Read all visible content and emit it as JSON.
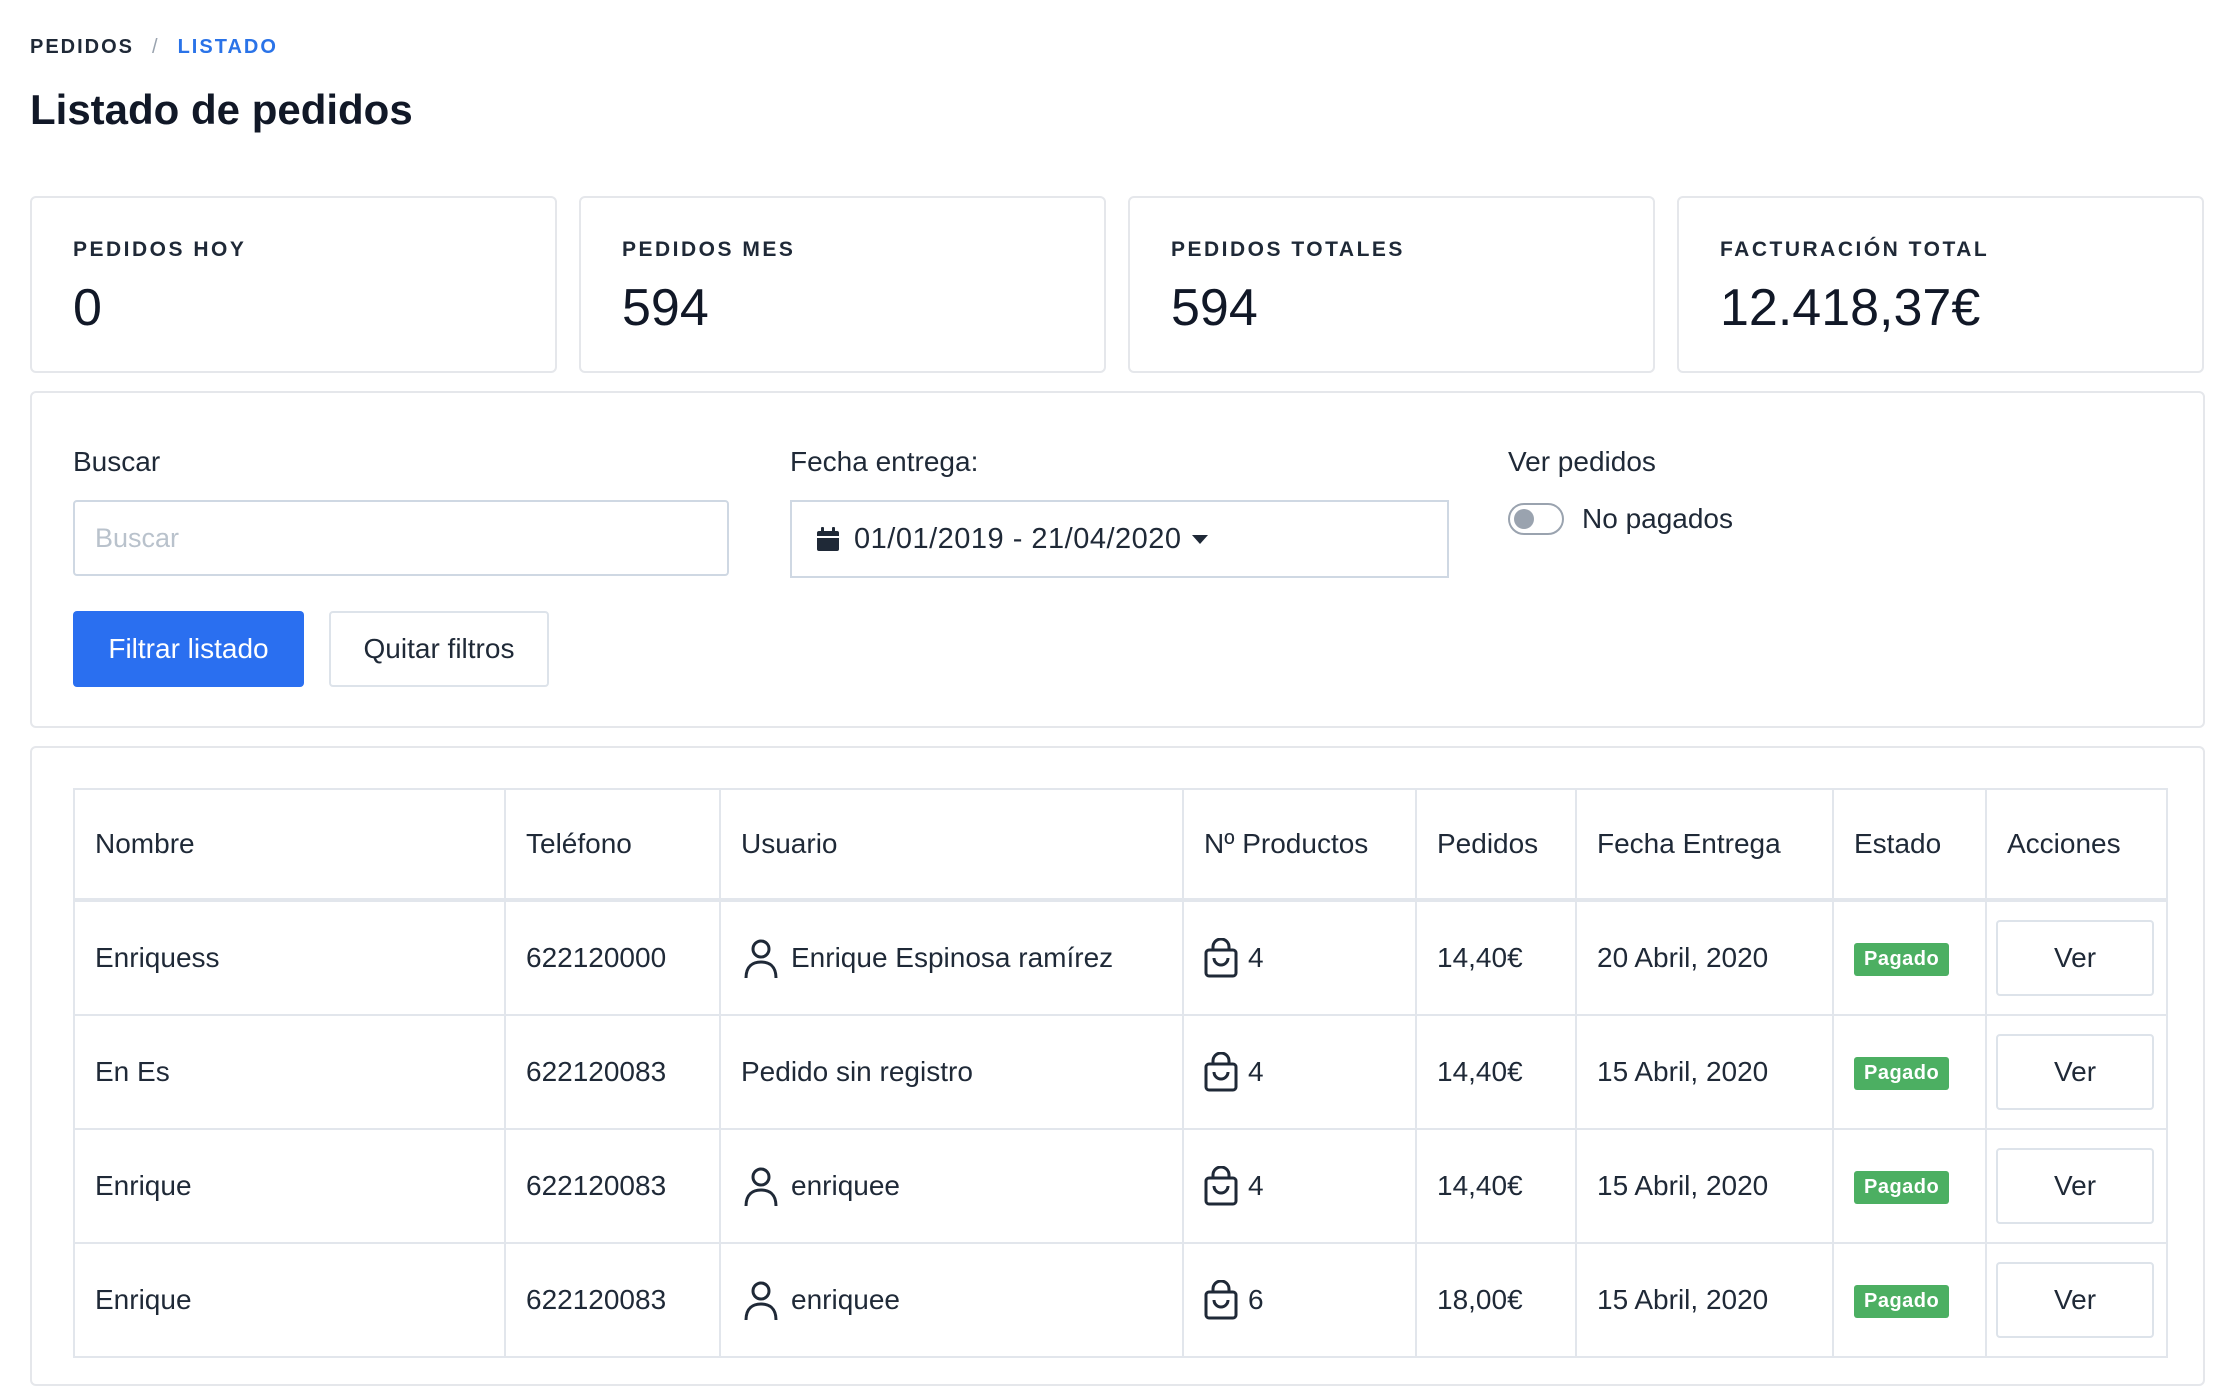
{
  "breadcrumb": {
    "root": "PEDIDOS",
    "separator": "/",
    "current": "LISTADO"
  },
  "title": "Listado de pedidos",
  "stats": [
    {
      "label": "PEDIDOS HOY",
      "value": "0"
    },
    {
      "label": "PEDIDOS MES",
      "value": "594"
    },
    {
      "label": "PEDIDOS TOTALES",
      "value": "594"
    },
    {
      "label": "FACTURACIÓN TOTAL",
      "value": "12.418,37€"
    }
  ],
  "filters": {
    "search_label": "Buscar",
    "search_placeholder": "Buscar",
    "date_label": "Fecha entrega:",
    "date_range": "01/01/2019 - 21/04/2020",
    "view_label": "Ver pedidos",
    "toggle_label": "No pagados",
    "apply_button": "Filtrar listado",
    "clear_button": "Quitar filtros"
  },
  "table": {
    "columns": [
      "Nombre",
      "Teléfono",
      "Usuario",
      "Nº Productos",
      "Pedidos",
      "Fecha Entrega",
      "Estado",
      "Acciones"
    ],
    "rows": [
      {
        "name": "Enriquess",
        "phone": "622120000",
        "user": "Enrique Espinosa ramírez",
        "has_user_icon": true,
        "products": "4",
        "amount": "14,40€",
        "date": "20 Abril, 2020",
        "status": "Pagado",
        "action": "Ver"
      },
      {
        "name": "En Es",
        "phone": "622120083",
        "user": "Pedido sin registro",
        "has_user_icon": false,
        "products": "4",
        "amount": "14,40€",
        "date": "15 Abril, 2020",
        "status": "Pagado",
        "action": "Ver"
      },
      {
        "name": "Enrique",
        "phone": "622120083",
        "user": "enriquee",
        "has_user_icon": true,
        "products": "4",
        "amount": "14,40€",
        "date": "15 Abril, 2020",
        "status": "Pagado",
        "action": "Ver"
      },
      {
        "name": "Enrique",
        "phone": "622120083",
        "user": "enriquee",
        "has_user_icon": true,
        "products": "6",
        "amount": "18,00€",
        "date": "15 Abril, 2020",
        "status": "Pagado",
        "action": "Ver"
      }
    ]
  },
  "colors": {
    "primary": "#2a6ff0",
    "breadcrumb_active": "#2a73e8",
    "status_paid": "#4caf62",
    "border": "#e5e7eb"
  },
  "icons": {
    "date": "calendar-icon",
    "user": "user-icon",
    "products": "shopping-bag-icon"
  }
}
